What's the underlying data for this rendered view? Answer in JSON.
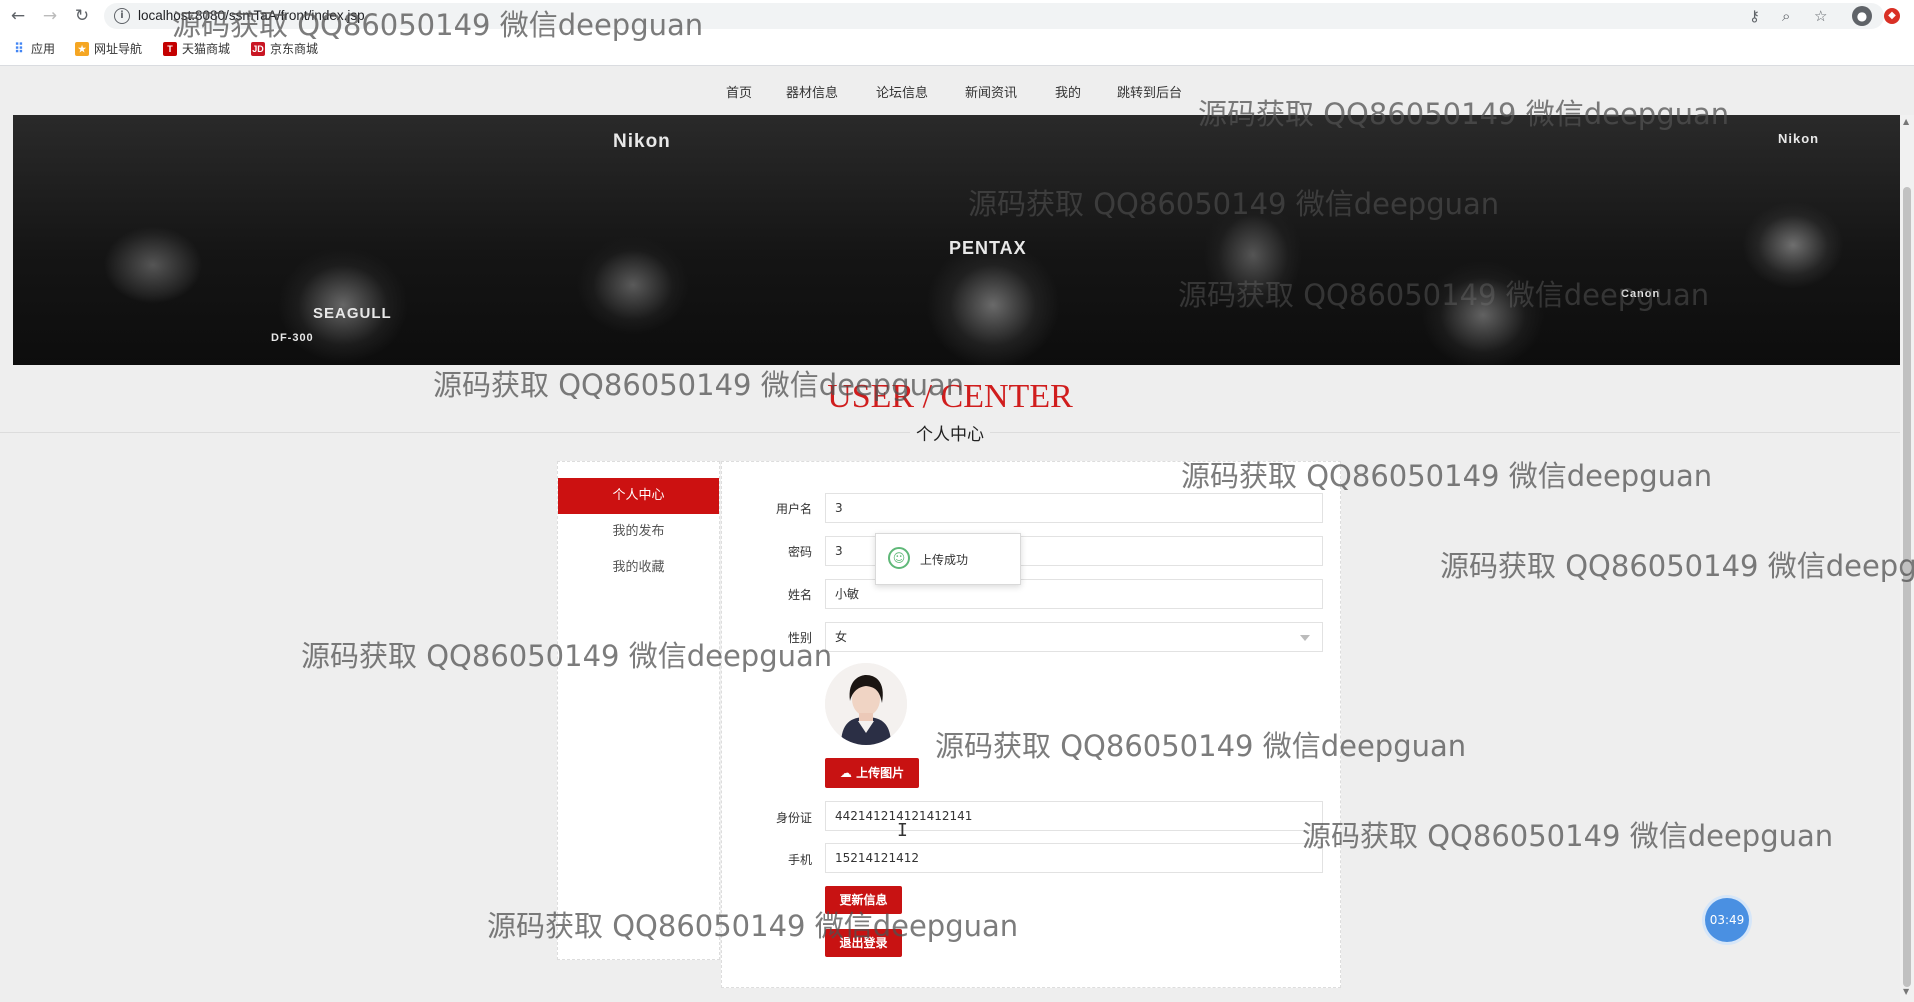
{
  "browser": {
    "url": "localhost:8080/ssmTaA/front/index.jsp",
    "bookmarks": [
      {
        "label": "应用"
      },
      {
        "label": "网址导航"
      },
      {
        "label": "天猫商城"
      },
      {
        "label": "京东商城"
      }
    ]
  },
  "nav": {
    "items": [
      "首页",
      "器材信息",
      "论坛信息",
      "新闻资讯",
      "我的",
      "跳转到后台"
    ]
  },
  "banner": {
    "brand_labels": [
      "Nikon",
      "PENTAX",
      "SEAGULL",
      "DF-300",
      "Nikon",
      "Canon"
    ]
  },
  "heading": {
    "english": "USER / CENTER",
    "chinese": "个人中心"
  },
  "sidebar": {
    "items": [
      "个人中心",
      "我的发布",
      "我的收藏"
    ]
  },
  "form": {
    "username_label": "用户名",
    "username_value": "3",
    "password_label": "密码",
    "password_value": "3",
    "name_label": "姓名",
    "name_value": "小敏",
    "gender_label": "性别",
    "gender_value": "女",
    "upload_label": "上传图片",
    "idcard_label": "身份证",
    "idcard_value": "442141214121412141",
    "phone_label": "手机",
    "phone_value": "15214121412",
    "update_label": "更新信息",
    "logout_label": "退出登录"
  },
  "toast": {
    "message": "上传成功"
  },
  "clock": {
    "time": "03:49"
  },
  "watermark": {
    "text": "源码获取 QQ86050149 微信deepguan"
  }
}
